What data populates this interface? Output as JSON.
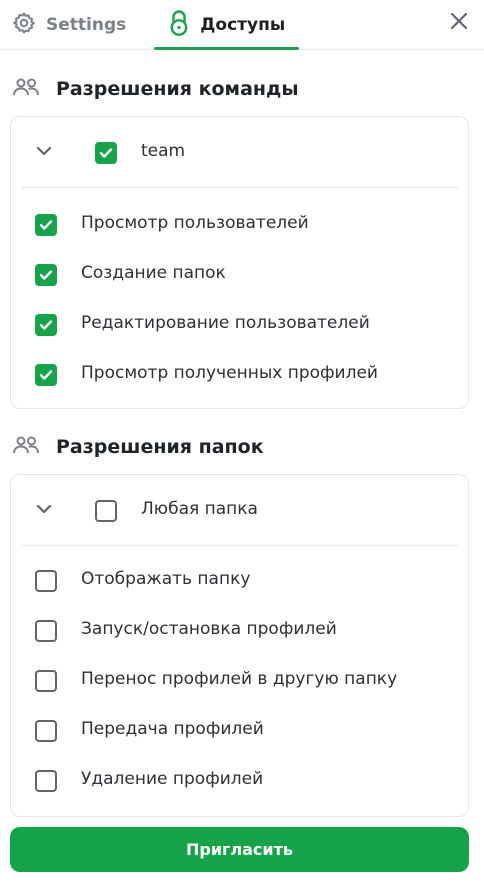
{
  "tabs": {
    "settings": {
      "label": "Settings",
      "icon": "gear-icon"
    },
    "access": {
      "label": "Доступы",
      "icon": "lock-icon",
      "active": true
    }
  },
  "close": {
    "icon": "close-icon"
  },
  "team_permissions": {
    "title": "Разрешения команды",
    "icon": "users-icon",
    "group": {
      "label": "team",
      "checked": true,
      "expanded": true
    },
    "items": [
      {
        "label": "Просмотр пользователей",
        "checked": true
      },
      {
        "label": "Создание папок",
        "checked": true
      },
      {
        "label": "Редактирование пользователей",
        "checked": true
      },
      {
        "label": "Просмотр полученных профилей",
        "checked": true
      }
    ]
  },
  "folder_permissions": {
    "title": "Разрешения папок",
    "icon": "users-icon",
    "group": {
      "label": "Любая папка",
      "checked": false,
      "expanded": true
    },
    "items": [
      {
        "label": "Отображать папку",
        "checked": false
      },
      {
        "label": "Запуск/остановка профилей",
        "checked": false
      },
      {
        "label": "Перенос профилей в другую папку",
        "checked": false
      },
      {
        "label": "Передача профилей",
        "checked": false
      },
      {
        "label": "Удаление профилей",
        "checked": false
      }
    ]
  },
  "invite_button": {
    "label": "Пригласить"
  },
  "colors": {
    "accent": "#17a34a",
    "text": "#2c3038",
    "muted": "#7c8189",
    "border": "#e3e6ea"
  }
}
